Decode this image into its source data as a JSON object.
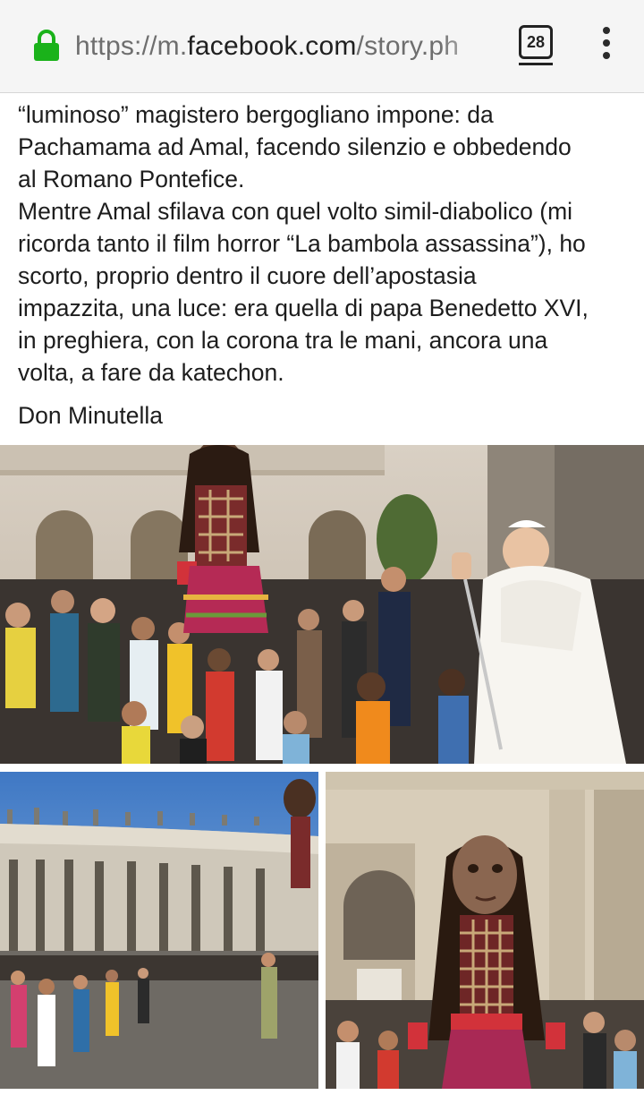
{
  "browser": {
    "url_prefix": "https://m.",
    "url_host": "facebook.com",
    "url_path": "/story.ph",
    "tab_count": "28",
    "lock_icon": "lock-icon",
    "menu_icon": "more-vert-icon",
    "accent_color": "#1ab21a"
  },
  "post": {
    "paragraph_1_lines": [
      "“luminoso” magistero bergogliano impone: da",
      "Pachamama ad Amal, facendo silenzio e obbedendo",
      "al Romano Pontefice."
    ],
    "paragraph_2_lines": [
      "Mentre Amal sfilava con quel volto simil-diabolico (mi",
      "ricorda tanto il film horror “La bambola assassina”), ho",
      "scorto, proprio dentro il cuore dell’apostasia",
      "impazzita, una luce: era quella di papa Benedetto XVI,",
      "in preghiera, con la corona tra le mani, ancora una",
      "volta, a fare da katechon."
    ],
    "signature": "Don Minutella"
  }
}
